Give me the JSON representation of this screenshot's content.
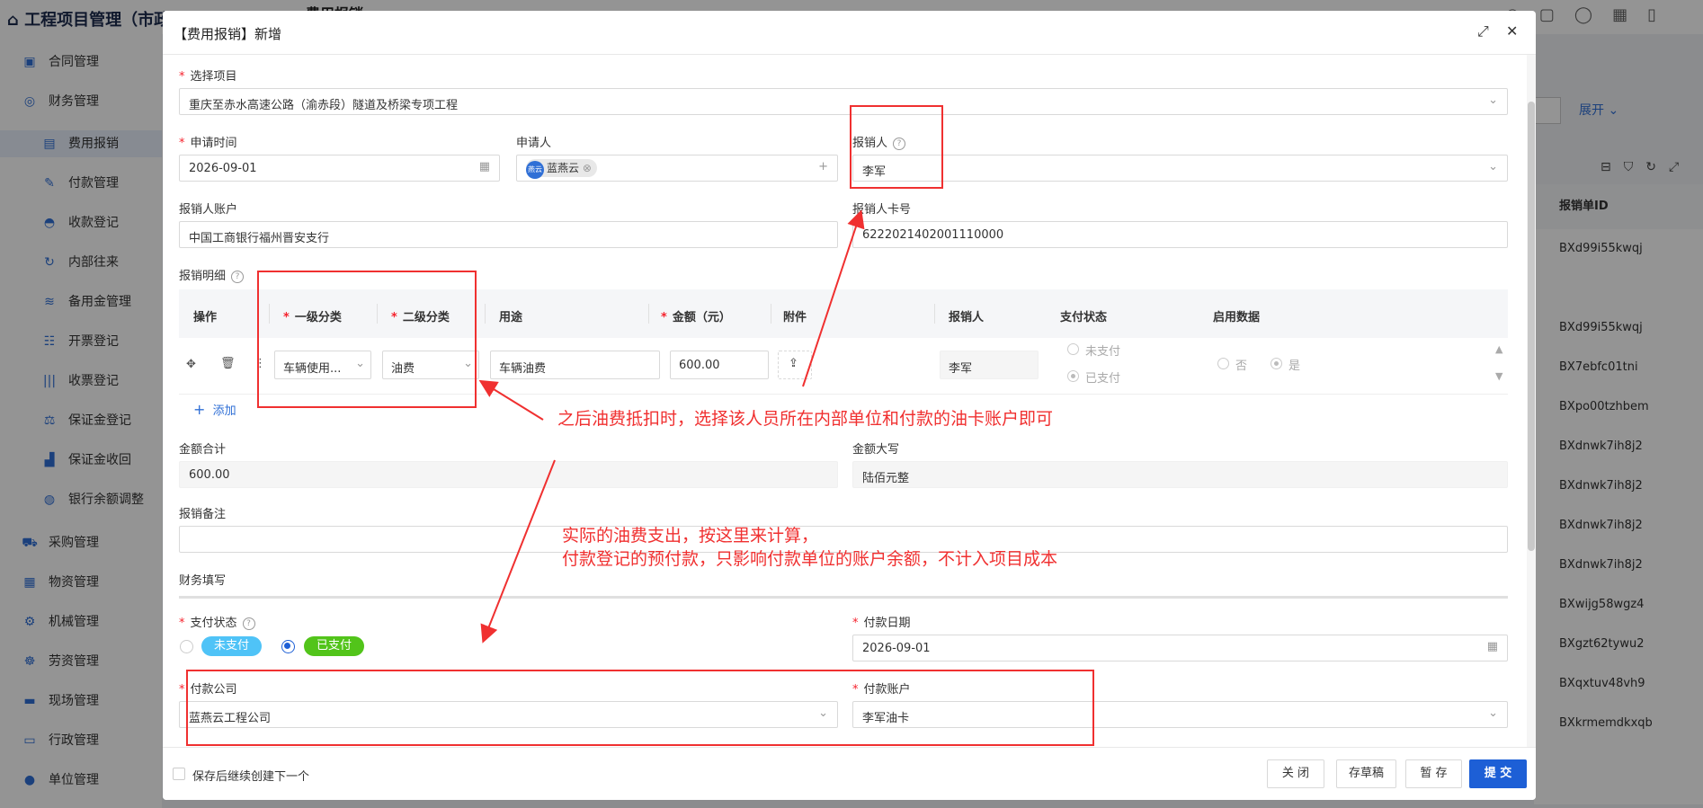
{
  "app": {
    "title": "工程项目管理（市政",
    "active_tab": "费用报销"
  },
  "sidebar": {
    "items": [
      {
        "label": "合同管理",
        "icon": "briefcase-icon",
        "glyph": "▣",
        "sub": false
      },
      {
        "label": "财务管理",
        "icon": "coins-icon",
        "glyph": "◎",
        "sub": false
      },
      {
        "label": "费用报销",
        "icon": "receipt-icon",
        "glyph": "▤",
        "sub": true,
        "active": true
      },
      {
        "label": "付款管理",
        "icon": "edit-icon",
        "glyph": "✎",
        "sub": true
      },
      {
        "label": "收款登记",
        "icon": "hand-coin-icon",
        "glyph": "◓",
        "sub": true
      },
      {
        "label": "内部往来",
        "icon": "refresh-icon",
        "glyph": "↻",
        "sub": true
      },
      {
        "label": "备用金管理",
        "icon": "stack-icon",
        "glyph": "≋",
        "sub": true
      },
      {
        "label": "开票登记",
        "icon": "invoice-icon",
        "glyph": "☷",
        "sub": true
      },
      {
        "label": "收票登记",
        "icon": "barcode-icon",
        "glyph": "|||",
        "sub": true
      },
      {
        "label": "保证金登记",
        "icon": "scale-icon",
        "glyph": "⚖",
        "sub": true
      },
      {
        "label": "保证金收回",
        "icon": "chart-icon",
        "glyph": "▟",
        "sub": true
      },
      {
        "label": "银行余额调整",
        "icon": "bag-icon",
        "glyph": "◍",
        "sub": true
      },
      {
        "label": "采购管理",
        "icon": "truck-icon",
        "glyph": "⛟",
        "sub": false
      },
      {
        "label": "物资管理",
        "icon": "box-icon",
        "glyph": "▦",
        "sub": false
      },
      {
        "label": "机械管理",
        "icon": "gears-icon",
        "glyph": "⚙",
        "sub": false
      },
      {
        "label": "劳资管理",
        "icon": "people-icon",
        "glyph": "☸",
        "sub": false
      },
      {
        "label": "现场管理",
        "icon": "site-icon",
        "glyph": "▬",
        "sub": false
      },
      {
        "label": "行政管理",
        "icon": "admin-icon",
        "glyph": "▭",
        "sub": false
      },
      {
        "label": "单位管理",
        "icon": "user-icon",
        "glyph": "●",
        "sub": false
      }
    ]
  },
  "background": {
    "expand_label": "展开",
    "table_header": "报销单ID",
    "table_rows": [
      "BXd99i55kwqj",
      "",
      "BXd99i55kwqj",
      "BX7ebfc01tni",
      "BXpo00tzhbem",
      "BXdnwk7ih8j2",
      "BXdnwk7ih8j2",
      "BXdnwk7ih8j2",
      "BXdnwk7ih8j2",
      "BXwijg58wgz4",
      "BXgzt62tywu2",
      "BXqxtuv48vh9",
      "BXkrmemdkxqb"
    ]
  },
  "modal": {
    "title": "【费用报销】新增",
    "project_label": "选择项目",
    "project_value": "重庆至赤水高速公路（渝赤段）隧道及桥梁专项工程",
    "apply_date_label": "申请时间",
    "apply_date_value": "2026-09-01",
    "applicant_label": "申请人",
    "applicant_avatar": "燕云",
    "applicant_value": "蓝燕云",
    "reimburser_label": "报销人",
    "reimburser_value": "李军",
    "account_label": "报销人账户",
    "account_value": "中国工商银行福州晋安支行",
    "card_label": "报销人卡号",
    "card_value": "6222021402001110000",
    "detail_label": "报销明细",
    "detail_table": {
      "headers": {
        "op": "操作",
        "cat1": "一级分类",
        "cat2": "二级分类",
        "purpose": "用途",
        "amount": "金额（元）",
        "attach": "附件",
        "person": "报销人",
        "pay_status": "支付状态",
        "enable": "启用数据"
      },
      "row": {
        "cat1": "车辆使用...",
        "cat2": "油费",
        "purpose": "车辆油费",
        "amount": "600.00",
        "person": "李军",
        "unpaid": "未支付",
        "paid": "已支付",
        "no": "否",
        "yes": "是"
      },
      "add_label": "添加"
    },
    "total_label": "金额合计",
    "total_value": "600.00",
    "total_cn_label": "金额大写",
    "total_cn_value": "陆佰元整",
    "remark_label": "报销备注",
    "remark_value": "",
    "finance_section": "财务填写",
    "pay_status_label": "支付状态",
    "pay_status_options": [
      "未支付",
      "已支付"
    ],
    "pay_date_label": "付款日期",
    "pay_date_value": "2026-09-01",
    "pay_company_label": "付款公司",
    "pay_company_value": "蓝燕云工程公司",
    "pay_account_label": "付款账户",
    "pay_account_value": "李军油卡",
    "footer": {
      "continue_label": "保存后继续创建下一个",
      "close": "关 闭",
      "draft": "存草稿",
      "hold": "暂 存",
      "submit": "提 交"
    }
  },
  "annotations": {
    "note1": "之后油费抵扣时，选择该人员所在内部单位和付款的油卡账户即可",
    "note2_line1": "实际的油费支出，按这里来计算，",
    "note2_line2": "付款登记的预付款，只影响付款单位的账户余额，不计入项目成本"
  },
  "colors": {
    "primary": "#1d5fd6",
    "unpaid_tag": "#4fc3f7",
    "paid_tag": "#52c41a",
    "annotation_red": "#f03030",
    "required_star": "#f5222d"
  }
}
